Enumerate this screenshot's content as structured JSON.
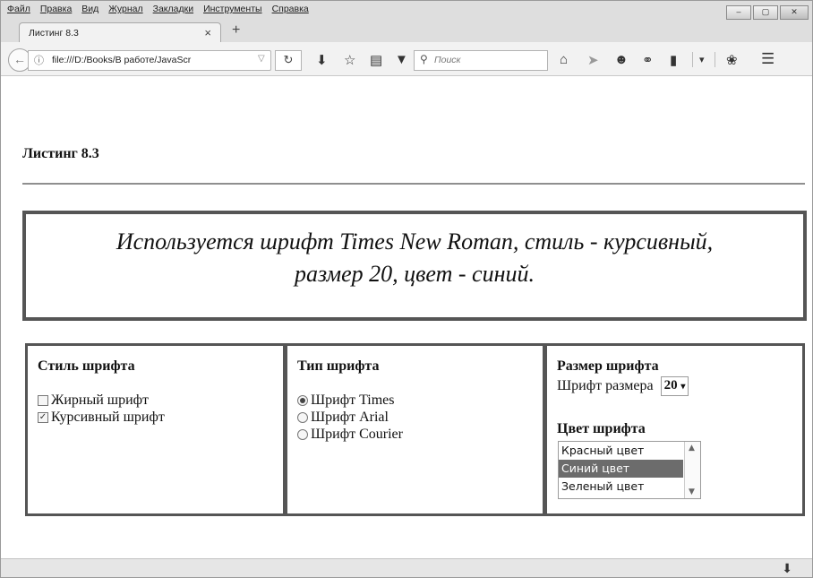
{
  "menu": [
    "Файл",
    "Правка",
    "Вид",
    "Журнал",
    "Закладки",
    "Инструменты",
    "Справка"
  ],
  "window_controls": {
    "minimize": "–",
    "maximize": "▢",
    "close": "✕"
  },
  "tab": {
    "title": "Листинг 8.3",
    "close": "×",
    "new_tab": "+"
  },
  "nav": {
    "url": "file:///D:/Books/В работе/JavaScr",
    "search_placeholder": "Поиск",
    "icons": [
      "back-icon",
      "info-icon",
      "reload-icon",
      "download-icon",
      "bookmark-star-icon",
      "reading-list-icon",
      "pocket-icon",
      "home-icon",
      "send-icon",
      "chat-icon",
      "extension-icon",
      "sidebar-icon",
      "dropdown-icon",
      "addon-icon",
      "menu-icon"
    ]
  },
  "page": {
    "heading": "Листинг 8.3",
    "banner_line1": "Используется шрифт Times New Roman, стиль - курсивный,",
    "banner_line2": "размер 20, цвет - синий."
  },
  "style_panel": {
    "title": "Стиль шрифта",
    "options": [
      {
        "label": "Жирный шрифт",
        "checked": false
      },
      {
        "label": "Курсивный шрифт",
        "checked": true
      }
    ]
  },
  "type_panel": {
    "title": "Тип шрифта",
    "options": [
      {
        "label": "Шрифт Times",
        "selected": true
      },
      {
        "label": "Шрифт Arial",
        "selected": false
      },
      {
        "label": "Шрифт Courier",
        "selected": false
      }
    ]
  },
  "size_panel": {
    "title": "Размер шрифта",
    "size_label": "Шрифт размера",
    "size_value": "20",
    "color_title": "Цвет шрифта",
    "colors": [
      {
        "label": "Красный цвет",
        "selected": false
      },
      {
        "label": "Синий цвет",
        "selected": true
      },
      {
        "label": "Зеленый цвет",
        "selected": false
      }
    ]
  }
}
